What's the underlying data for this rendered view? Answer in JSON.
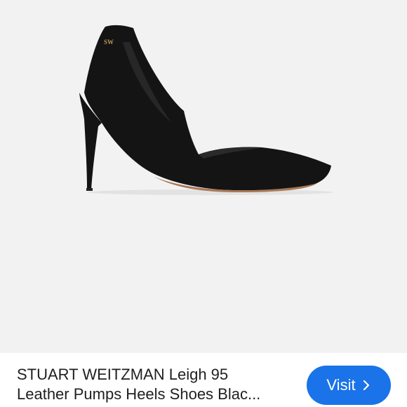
{
  "product": {
    "image_alt": "Black leather pointed-toe pump",
    "logo_text": "SW",
    "title_line1": "STUART WEITZMAN Leigh 95",
    "title_line2": "Leather Pumps Heels Shoes Blac..."
  },
  "actions": {
    "visit_label": "Visit",
    "visit_icon": "chevron-right-icon"
  },
  "colors": {
    "background": "#f2f2f2",
    "button": "#1a73e8",
    "shoe": "#111111"
  }
}
